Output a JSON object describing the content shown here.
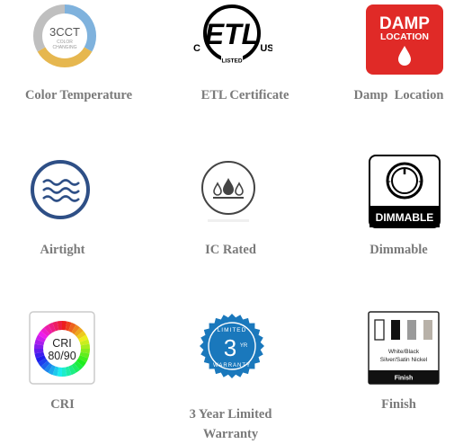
{
  "features": {
    "color_temperature": {
      "label": "Color Temperature",
      "badge_main": "3CCT",
      "badge_sub1": "COLOR",
      "badge_sub2": "CHANGING",
      "colors": [
        "#7fb2dd",
        "#e6b74f",
        "#bfbfbf"
      ]
    },
    "etl_certificate": {
      "label": "ETL Certificate",
      "mark": "ETL",
      "left": "C",
      "right": "US",
      "listed": "LISTED"
    },
    "damp_location": {
      "label": "Damp  Location",
      "line1": "DAMP",
      "line2": "LOCATION",
      "color": "#e02a27"
    },
    "airtight": {
      "label": "Airtight",
      "color": "#2e4f86",
      "icon": "wind-waves-icon"
    },
    "ic_rated": {
      "label": "IC Rated",
      "icon": "drops-icon"
    },
    "dimmable": {
      "label": "Dimmable",
      "badge": "DIMMABLE",
      "minus": "−",
      "plus": "+"
    },
    "cri": {
      "label": "CRI",
      "line1": "CRI",
      "line2": "80/90"
    },
    "warranty": {
      "label_line1": "3 Year Limited",
      "label_line2": "Warranty",
      "top": "LIMITED",
      "number": "3",
      "suffix": "YR",
      "bottom": "WARRANTY",
      "color": "#1a78bc"
    },
    "finish": {
      "label": "Finish",
      "line1": "White/Black",
      "line2": "Silver/Satin Nickel",
      "footer": "Finish"
    }
  }
}
